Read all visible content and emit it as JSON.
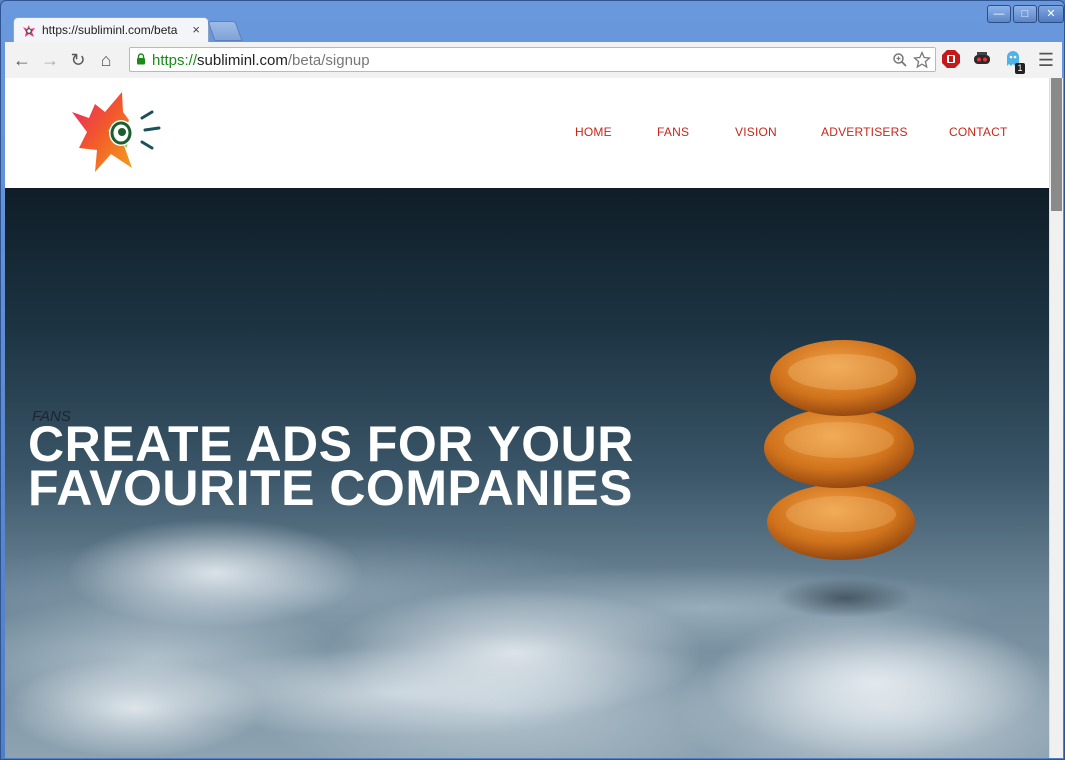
{
  "browser": {
    "tab_title": "https://subliminl.com/beta",
    "tab_close": "×",
    "url_scheme": "https://",
    "url_host": "subliminl.com",
    "url_path": "/beta/signup",
    "ext_badge": "1"
  },
  "nav": {
    "items": [
      {
        "label": "HOME"
      },
      {
        "label": "FANS"
      },
      {
        "label": "VISION"
      },
      {
        "label": "ADVERTISERS"
      },
      {
        "label": "CONTACT"
      }
    ]
  },
  "hero": {
    "kicker": "FANS",
    "headline_line1": "CREATE ADS FOR YOUR",
    "headline_line2": "FAVOURITE COMPANIES"
  },
  "colors": {
    "accent": "#c8261b",
    "url_secure": "#1a8a1a"
  },
  "icons": [
    "back-icon",
    "forward-icon",
    "reload-icon",
    "home-icon",
    "lock-icon",
    "zoom-icon",
    "star-icon",
    "stop-extension-icon",
    "mask-extension-icon",
    "ghostery-icon",
    "menu-icon"
  ]
}
